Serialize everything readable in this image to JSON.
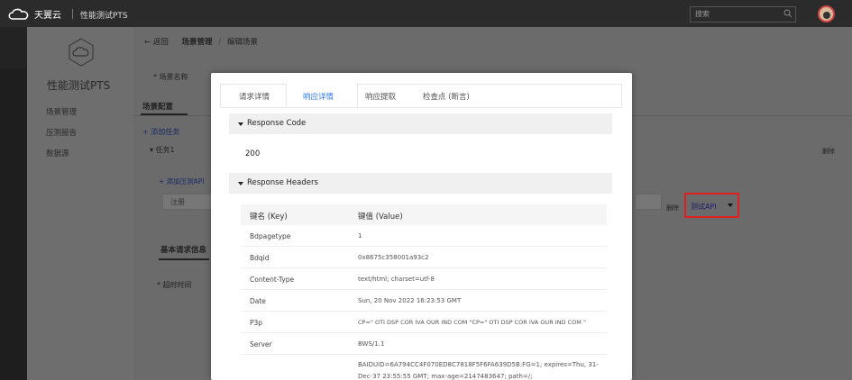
{
  "topbar": {
    "logo_text": "天翼云",
    "product": "性能测试PTS",
    "search_placeholder": "搜索"
  },
  "sidebar": {
    "title": "性能测试PTS",
    "items": [
      {
        "label": "场景管理"
      },
      {
        "label": "压测报告"
      },
      {
        "label": "数据源"
      }
    ]
  },
  "main": {
    "back": "← 返回",
    "breadcrumb_1": "场景管理",
    "breadcrumb_sep": "/",
    "breadcrumb_2": "编辑场景",
    "scene_name_label": "* 场景名称",
    "scene_tab": "场景配置",
    "add_task": "+ 添加任务",
    "task_name": "▾ 任务1",
    "add_api": "+ 添加压测API",
    "api_field": "注册",
    "right_text": "删除",
    "right_text2": "删除",
    "test_api": "测试API",
    "basic_tab": "基本请求信息",
    "timeout_label": "* 超时时间"
  },
  "modal": {
    "tabs": [
      "请求详情",
      "响应详情",
      "响应提取",
      "检查点 (断言)"
    ],
    "active_tab": 1,
    "response_code_title": "Response Code",
    "response_code": "200",
    "response_headers_title": "Response Headers",
    "table_head": {
      "key": "键名 (Key)",
      "value": "键值 (Value)"
    },
    "headers": [
      {
        "key": "Bdpagetype",
        "value": "1"
      },
      {
        "key": "Bdqid",
        "value": "0x8675c358001a93c2"
      },
      {
        "key": "Content-Type",
        "value": "text/html; charset=utf-8"
      },
      {
        "key": "Date",
        "value": "Sun, 20 Nov 2022 16:23:53 GMT"
      },
      {
        "key": "P3p",
        "value": "CP=\" OTI DSP COR IVA OUR IND COM \"CP=\" OTI DSP COR IVA OUR IND COM \""
      },
      {
        "key": "Server",
        "value": "BWS/1.1"
      },
      {
        "key": "",
        "value": "BAIDUID=6A794CC4F070ED8C7818F5F6FA639D5B:FG=1; expires=Thu, 31-Dec-37 23:55:55 GMT; max-age=2147483647; path=/; domain=.baidu.comBIDUPSID"
      }
    ]
  },
  "colors": {
    "accent": "#2e7bf6",
    "highlight_border": "#e02020",
    "topbar": "#2b2b2b"
  }
}
